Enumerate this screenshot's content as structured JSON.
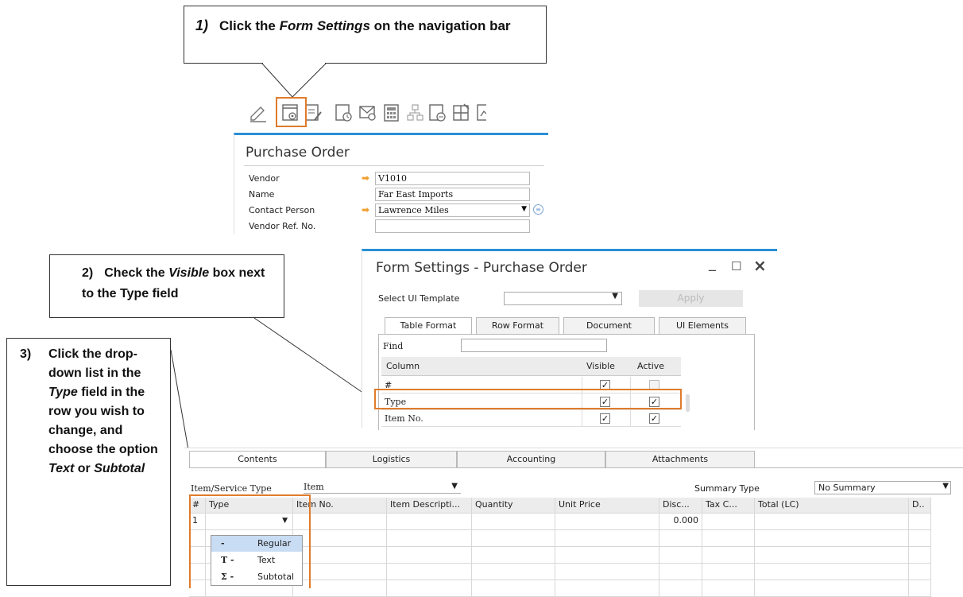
{
  "callouts": {
    "step1": {
      "num": "1)",
      "pre": "Click the ",
      "em": "Form Settings",
      "post": " on the navigation bar"
    },
    "step2": {
      "num": "2)",
      "pre": "Check the ",
      "em": "Visible",
      "post": " box next to the ",
      "cut": "Type field"
    },
    "step3": {
      "num": "3)",
      "line1": "Click the drop-down list in the ",
      "em1": "Type",
      "line2": " field in the row you wish to change, and choose the option ",
      "em2": "Text",
      "line3": " or ",
      "em3": "Subtotal"
    }
  },
  "toolbar": {
    "icons": [
      "edit-icon",
      "form-settings-icon",
      "settings-edit-icon",
      "document-link-icon",
      "email-icon",
      "calculator-icon",
      "relationship-map-icon",
      "report-icon",
      "ui-elements-icon",
      "more-icon"
    ]
  },
  "purchase_order": {
    "title": "Purchase Order",
    "fields": [
      {
        "label": "Vendor",
        "value": "V1010",
        "link": true
      },
      {
        "label": "Name",
        "value": "Far East Imports",
        "link": false
      },
      {
        "label": "Contact Person",
        "value": "Lawrence Miles",
        "link": true
      },
      {
        "label": "Vendor Ref. No.",
        "value": "",
        "link": false
      }
    ]
  },
  "form_settings": {
    "title": "Form Settings - Purchase Order",
    "min_label": "_",
    "max_label": "☐",
    "close_label": "×",
    "template_label": "Select UI Template",
    "template_value": "",
    "apply_label": "Apply",
    "tabs": [
      "Table Format",
      "Row Format",
      "Document",
      "UI Elements"
    ],
    "find_label": "Find",
    "columns_header": {
      "column": "Column",
      "visible": "Visible",
      "active": "Active"
    },
    "rows": [
      {
        "name": "#",
        "visible": true,
        "active": false
      },
      {
        "name": "Type",
        "visible": true,
        "active": true
      },
      {
        "name": "Item No.",
        "visible": true,
        "active": true
      }
    ]
  },
  "document": {
    "tabs": [
      "Contents",
      "Logistics",
      "Accounting",
      "Attachments"
    ],
    "item_type_label": "Item/Service Type",
    "item_type_value": "Item",
    "summary_label": "Summary Type",
    "summary_value": "No Summary",
    "grid_headers": [
      "#",
      "Type",
      "Item No.",
      "Item Descripti...",
      "Quantity",
      "Unit Price",
      "Disc...",
      "Tax C...",
      "Total (LC)",
      "D.."
    ],
    "row1": {
      "num": "1",
      "discount": "0.000"
    },
    "type_options": [
      {
        "symbol": "-",
        "label": "Regular"
      },
      {
        "symbol": "T -",
        "label": "Text"
      },
      {
        "symbol": "Σ -",
        "label": "Subtotal"
      }
    ]
  },
  "colors": {
    "highlight": "#e07b2a",
    "accent_blue": "#2a8fd6",
    "link_arrow": "#f0a030"
  }
}
